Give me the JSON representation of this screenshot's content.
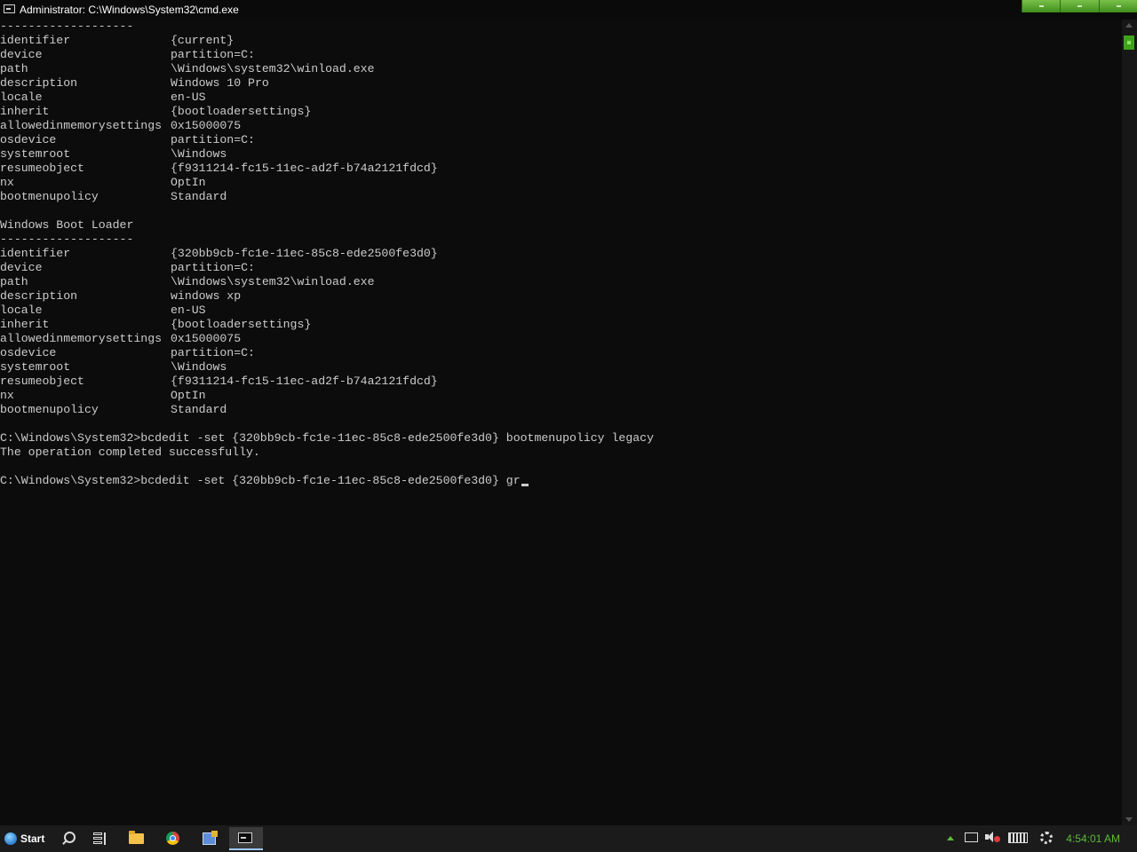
{
  "window": {
    "title": "Administrator: C:\\Windows\\System32\\cmd.exe",
    "controls": [
      "minimize",
      "maximize",
      "close"
    ]
  },
  "console": {
    "lines": [
      {
        "text": "-------------------"
      },
      {
        "key": "identifier",
        "val": "{current}"
      },
      {
        "key": "device",
        "val": "partition=C:"
      },
      {
        "key": "path",
        "val": "\\Windows\\system32\\winload.exe"
      },
      {
        "key": "description",
        "val": "Windows 10 Pro"
      },
      {
        "key": "locale",
        "val": "en-US"
      },
      {
        "key": "inherit",
        "val": "{bootloadersettings}"
      },
      {
        "key": "allowedinmemorysettings",
        "val": "0x15000075"
      },
      {
        "key": "osdevice",
        "val": "partition=C:"
      },
      {
        "key": "systemroot",
        "val": "\\Windows"
      },
      {
        "key": "resumeobject",
        "val": "{f9311214-fc15-11ec-ad2f-b74a2121fdcd}"
      },
      {
        "key": "nx",
        "val": "OptIn"
      },
      {
        "key": "bootmenupolicy",
        "val": "Standard"
      },
      {
        "text": ""
      },
      {
        "text": "Windows Boot Loader"
      },
      {
        "text": "-------------------"
      },
      {
        "key": "identifier",
        "val": "{320bb9cb-fc1e-11ec-85c8-ede2500fe3d0}"
      },
      {
        "key": "device",
        "val": "partition=C:"
      },
      {
        "key": "path",
        "val": "\\Windows\\system32\\winload.exe"
      },
      {
        "key": "description",
        "val": "windows xp"
      },
      {
        "key": "locale",
        "val": "en-US"
      },
      {
        "key": "inherit",
        "val": "{bootloadersettings}"
      },
      {
        "key": "allowedinmemorysettings",
        "val": "0x15000075"
      },
      {
        "key": "osdevice",
        "val": "partition=C:"
      },
      {
        "key": "systemroot",
        "val": "\\Windows"
      },
      {
        "key": "resumeobject",
        "val": "{f9311214-fc15-11ec-ad2f-b74a2121fdcd}"
      },
      {
        "key": "nx",
        "val": "OptIn"
      },
      {
        "key": "bootmenupolicy",
        "val": "Standard"
      },
      {
        "text": ""
      },
      {
        "text": "C:\\Windows\\System32>bcdedit -set {320bb9cb-fc1e-11ec-85c8-ede2500fe3d0} bootmenupolicy legacy"
      },
      {
        "text": "The operation completed successfully."
      },
      {
        "text": ""
      }
    ],
    "prompt": "C:\\Windows\\System32>",
    "current_input": "bcdedit -set {320bb9cb-fc1e-11ec-85c8-ede2500fe3d0} gr"
  },
  "taskbar": {
    "start_label": "Start",
    "icons": [
      "search-icon",
      "task-view-icon",
      "file-explorer-icon",
      "chrome-icon",
      "app-icon",
      "cmd-icon"
    ],
    "tray_icons": [
      "show-hidden-icons-chevron",
      "network-icon",
      "volume-muted-icon",
      "keyboard-icon",
      "settings-gear-icon"
    ],
    "clock": "4:54:01 AM",
    "accent_color": "#5dbb3a"
  }
}
